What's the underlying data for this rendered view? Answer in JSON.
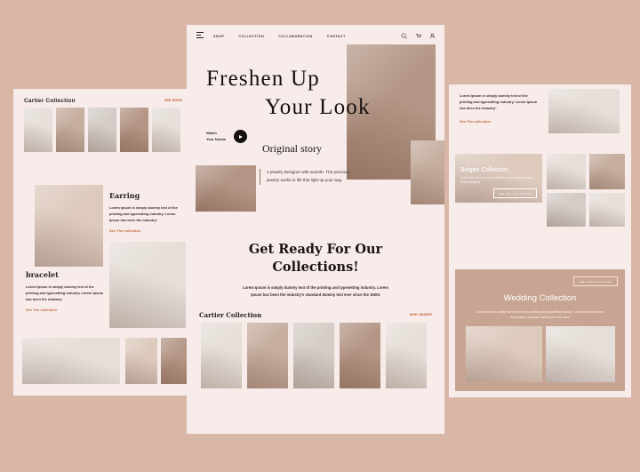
{
  "meta": {
    "background_color": "#d8b7a7",
    "panel_color": "#f7ecea",
    "accent_color": "#c1663b",
    "dark_text_color": "#1a1412",
    "wedding_panel_color": "#c8a593"
  },
  "nav": {
    "menu_icon": "hamburger-menu-icon",
    "links": [
      "SHOP",
      "COLLECTION",
      "COLLABORATION",
      "CONTACT"
    ],
    "icons": [
      "search-icon",
      "cart-icon",
      "user-icon"
    ]
  },
  "hero": {
    "line1": "Freshen  Up",
    "line2": "Your Look",
    "watch_line1": "Watch",
    "watch_line2": "Your Needs",
    "play_icon": "play-icon"
  },
  "story": {
    "title": "Original story",
    "body": "A jewelry Designer with warmth. The precious jewelry works in life that light up your way."
  },
  "get_ready": {
    "title_line1": "Get Ready For Our",
    "title_line2": "Collections!",
    "body": "Lorem Ipsum is simply dummy text of the printing and typesetting industry. Lorem Ipsum has been the industry's standard dummy text ever since the 1500s"
  },
  "center_collection": {
    "title": "Cartier Collection",
    "see_more": "see more",
    "thumb_count": 5
  },
  "left": {
    "collection_title": "Cartier Collection",
    "see_more": "see more",
    "thumb_count": 5,
    "earring": {
      "title": "Earring",
      "body": "Lorem Ipsum is simply dummy text of the printing and typesetting industry. Lorem Ipsum has been the industry'.",
      "link": "See The collection"
    },
    "bracelet": {
      "title": "bracelet",
      "body": "Lorem Ipsum is simply dummy text of the printing and typesetting industry. Lorem Ipsum has been the industry'.",
      "link": "See The collection"
    }
  },
  "right": {
    "intro": {
      "body": "Lorem Ipsum is simply dummy text of the printing and typesetting industry. Lorem Ipsum has been the industry'.",
      "link": "See The collection"
    },
    "bvlgari": {
      "title": "Bvlgari Collection",
      "body": "Check out our new Gold collection, new patterns have been designed",
      "button": "SEE THE COLLECTION"
    },
    "wedding": {
      "title": "Wedding Collection",
      "body": "Lorem Ipsum is simply dummy text of the printing and typesetting industry. Lorem Ipsum has been the industry's standard dummy text ever since",
      "button": "SEE THE COLLECTION"
    }
  }
}
